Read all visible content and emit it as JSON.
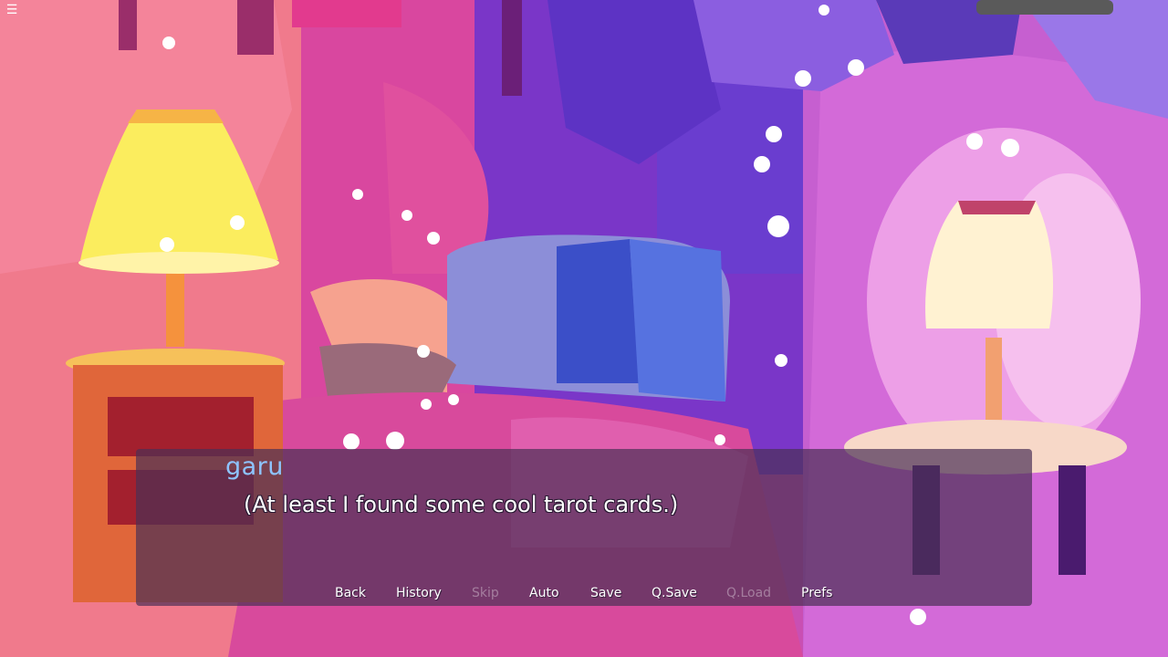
{
  "menu": {
    "icon": "hamburger-icon",
    "glyph": "☰"
  },
  "dialogue": {
    "speaker": "garu",
    "text": "(At least I found some cool tarot cards.)"
  },
  "quick_menu": {
    "back": "Back",
    "history": "History",
    "skip": "Skip",
    "auto": "Auto",
    "save": "Save",
    "qsave": "Q.Save",
    "qload": "Q.Load",
    "prefs": "Prefs"
  },
  "colors": {
    "speaker": "#8ec4ff",
    "dialogue_text": "#ffffff",
    "disabled": "rgba(255,255,255,0.35)"
  }
}
